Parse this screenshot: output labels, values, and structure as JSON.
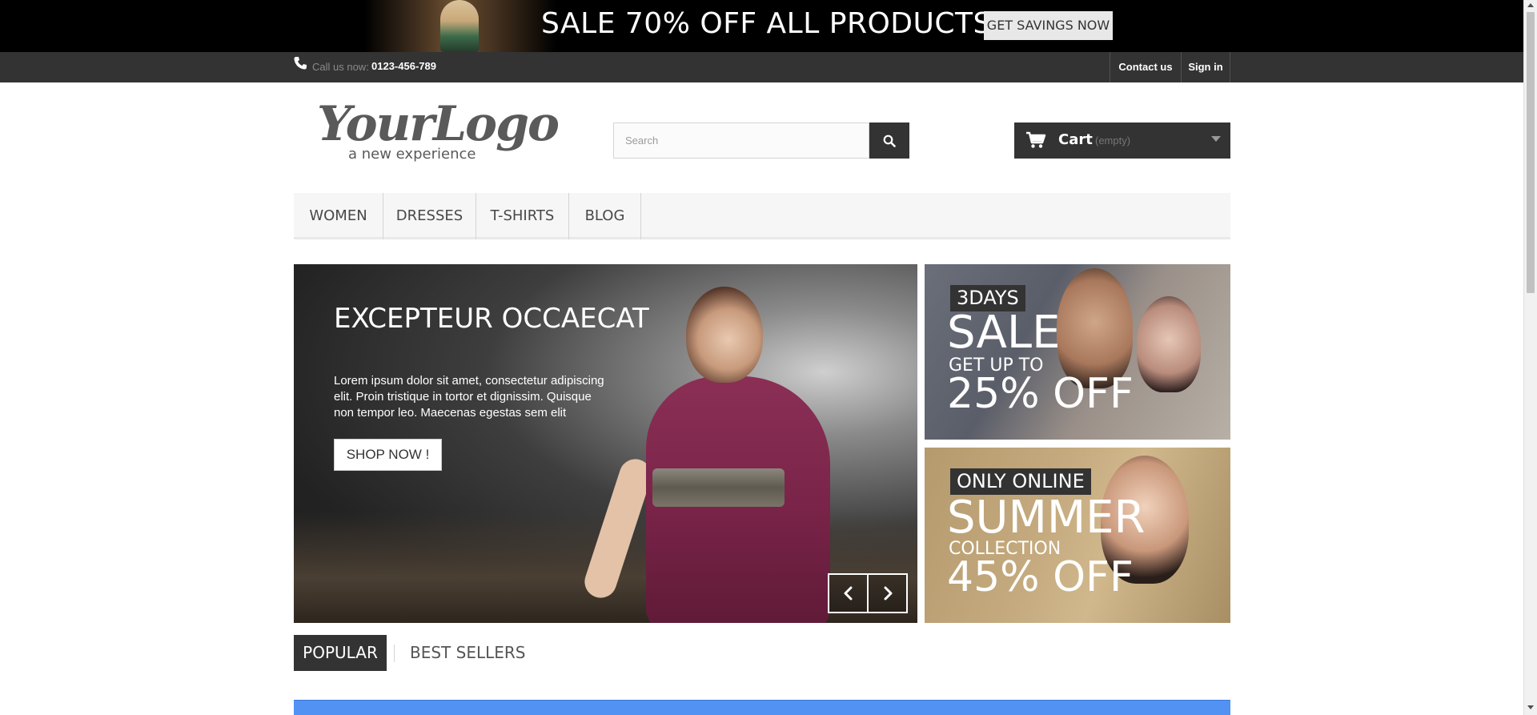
{
  "top_banner": {
    "text": "SALE 70% OFF ALL PRODUCTS",
    "button_label": "GET SAVINGS NOW"
  },
  "utility_bar": {
    "call_label": "Call us now:",
    "phone_number": "0123-456-789",
    "links": {
      "contact": "Contact us",
      "signin": "Sign in"
    }
  },
  "header": {
    "logo_text": "YourLogo",
    "logo_tagline": "a new experience",
    "search": {
      "placeholder": "Search"
    },
    "cart": {
      "label": "Cart",
      "status": "(empty)"
    }
  },
  "nav": {
    "items": [
      "WOMEN",
      "DRESSES",
      "T-SHIRTS",
      "BLOG"
    ]
  },
  "hero": {
    "title": "EXCEPTEUR OCCAECAT",
    "text": "Lorem ipsum dolor sit amet, consectetur adipiscing elit. Proin tristique in tortor et dignissim. Quisque non tempor leo. Maecenas egestas sem elit",
    "button_label": "SHOP NOW !"
  },
  "promos": {
    "sale": {
      "tag": "3DAYS",
      "headline": "SALE",
      "subline": "GET UP TO",
      "offer": "25% OFF"
    },
    "summer": {
      "tag": "ONLY ONLINE",
      "headline": "SUMMER",
      "subline": "COLLECTION",
      "offer": "45% OFF"
    }
  },
  "tabs": {
    "popular": "POPULAR",
    "best_sellers": "BEST SELLERS"
  },
  "colors": {
    "dark": "#333333",
    "nav_bg": "#f6f6f6",
    "info_blue": "#5192f3"
  },
  "icons": [
    "phone-icon",
    "search-icon",
    "cart-icon",
    "chevron-down-icon",
    "chevron-left-icon",
    "chevron-right-icon"
  ]
}
